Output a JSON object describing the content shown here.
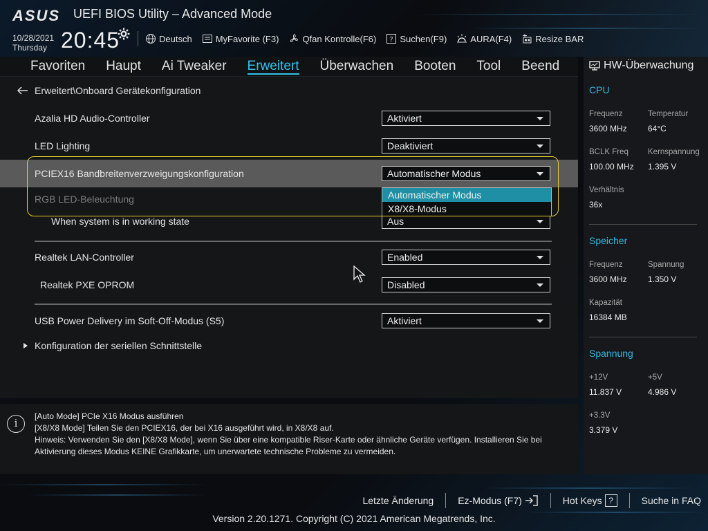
{
  "header": {
    "logo": "ASUS",
    "title": "UEFI BIOS Utility – Advanced Mode",
    "date": "10/28/2021",
    "weekday": "Thursday",
    "time": "20:45",
    "toolbar": [
      {
        "label": "Deutsch",
        "icon": "globe-icon"
      },
      {
        "label": "MyFavorite (F3)",
        "icon": "favorite-icon"
      },
      {
        "label": "Qfan Kontrolle(F6)",
        "icon": "fan-icon"
      },
      {
        "label": "Suchen(F9)",
        "icon": "search-help-icon"
      },
      {
        "label": "AURA(F4)",
        "icon": "aura-icon"
      },
      {
        "label": "Resize BAR",
        "icon": "resize-bar-icon"
      }
    ]
  },
  "tabs": [
    {
      "label": "Favoriten"
    },
    {
      "label": "Haupt"
    },
    {
      "label": "Ai Tweaker"
    },
    {
      "label": "Erweitert",
      "active": true
    },
    {
      "label": "Überwachen"
    },
    {
      "label": "Booten"
    },
    {
      "label": "Tool"
    },
    {
      "label": "Beend"
    }
  ],
  "breadcrumb": "Erweitert\\Onboard Gerätekonfiguration",
  "settings": [
    {
      "label": "Azalia HD Audio-Controller",
      "value": "Aktiviert"
    },
    {
      "label": "LED Lighting",
      "value": "Deaktiviert"
    },
    {
      "label": "PCIEX16 Bandbreitenverzweigungskonfiguration",
      "value": "Automatischer Modus"
    },
    {
      "label": "RGB LED-Beleuchtung",
      "value": ""
    },
    {
      "label": "When system is in working state",
      "value": "Aus"
    },
    {
      "label": "Realtek LAN-Controller",
      "value": "Enabled"
    },
    {
      "label": "Realtek PXE OPROM",
      "value": "Disabled"
    },
    {
      "label": "USB Power Delivery im Soft-Off-Modus (S5)",
      "value": "Aktiviert"
    }
  ],
  "popup": {
    "options": [
      "Automatischer Modus",
      "X8/X8-Modus"
    ],
    "selected": "Automatischer Modus"
  },
  "submenu": "Konfiguration der seriellen Schnittstelle",
  "help": {
    "lines": [
      "[Auto Mode] PCIe X16 Modus ausführen",
      "[X8/X8 Mode] Teilen Sie den PCIEX16, der bei X16 ausgeführt wird, in X8/X8 auf.",
      "Hinweis: Verwenden Sie den [X8/X8 Mode], wenn Sie über eine kompatible Riser-Karte oder ähnliche Geräte verfügen. Installieren Sie bei Aktivierung dieses Modus KEINE Grafikkarte, um unerwartete technische Probleme zu vermeiden."
    ]
  },
  "hw_monitor": {
    "title": "HW-Überwachung",
    "cpu": {
      "heading": "CPU",
      "freq_label": "Frequenz",
      "freq": "3600 MHz",
      "temp_label": "Temperatur",
      "temp": "64°C",
      "bclk_label": "BCLK Freq",
      "bclk": "100.00 MHz",
      "core_label": "Kernspannung",
      "core": "1.395 V",
      "ratio_label": "Verhältnis",
      "ratio": "36x"
    },
    "memory": {
      "heading": "Speicher",
      "freq_label": "Frequenz",
      "freq": "3600 MHz",
      "volt_label": "Spannung",
      "volt": "1.350 V",
      "cap_label": "Kapazität",
      "cap": "16384 MB"
    },
    "voltage": {
      "heading": "Spannung",
      "v12_label": "+12V",
      "v12": "11.837 V",
      "v5_label": "+5V",
      "v5": "4.986 V",
      "v33_label": "+3.3V",
      "v33": "3.379 V"
    }
  },
  "footer": {
    "last_change": "Letzte Änderung",
    "ez_mode": "Ez-Modus (F7)",
    "hot_keys": "Hot Keys",
    "hot_keys_key": "?",
    "faq": "Suche in FAQ",
    "version": "Version 2.20.1271. Copyright (C) 2021 American Megatrends, Inc."
  },
  "colors": {
    "accent": "#35c2e8",
    "highlight_border": "#e6cf2f",
    "popup_selected": "#1f8fa6"
  }
}
